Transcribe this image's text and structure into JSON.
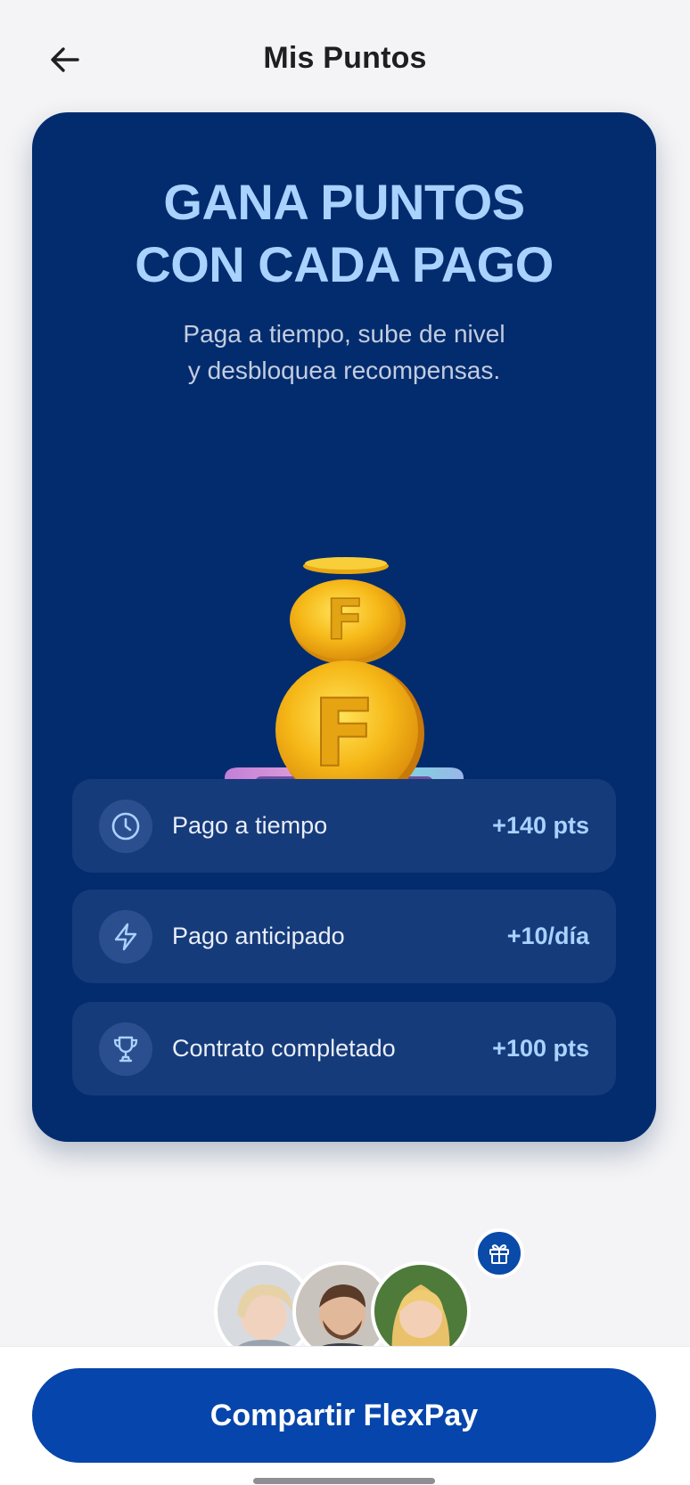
{
  "header": {
    "title": "Mis Puntos",
    "back_icon": "arrow-left-icon"
  },
  "hero": {
    "headline_line1": "GANA PUNTOS",
    "headline_line2": "CON CADA PAGO",
    "subtitle_line1": "Paga a tiempo, sube de nivel",
    "subtitle_line2": "y desbloquea recompensas.",
    "illustration": "coin-stack-illustration",
    "coin_letter": "F"
  },
  "rewards": [
    {
      "icon": "clock-icon",
      "label": "Pago a tiempo",
      "value": "+140 pts"
    },
    {
      "icon": "lightning-icon",
      "label": "Pago anticipado",
      "value": "+10/día"
    },
    {
      "icon": "trophy-icon",
      "label": "Contrato completado",
      "value": "+100 pts"
    }
  ],
  "referral": {
    "badge_icon": "gift-icon",
    "avatars": [
      "avatar-woman-short-hair",
      "avatar-man-beard",
      "avatar-woman-blonde"
    ]
  },
  "footer": {
    "share_label": "Compartir FlexPay"
  },
  "colors": {
    "card_bg": "#032c6e",
    "row_bg": "#163b7b",
    "accent_text": "#a9d2ff",
    "primary_button": "#0645ab",
    "page_bg": "#f4f4f6"
  }
}
